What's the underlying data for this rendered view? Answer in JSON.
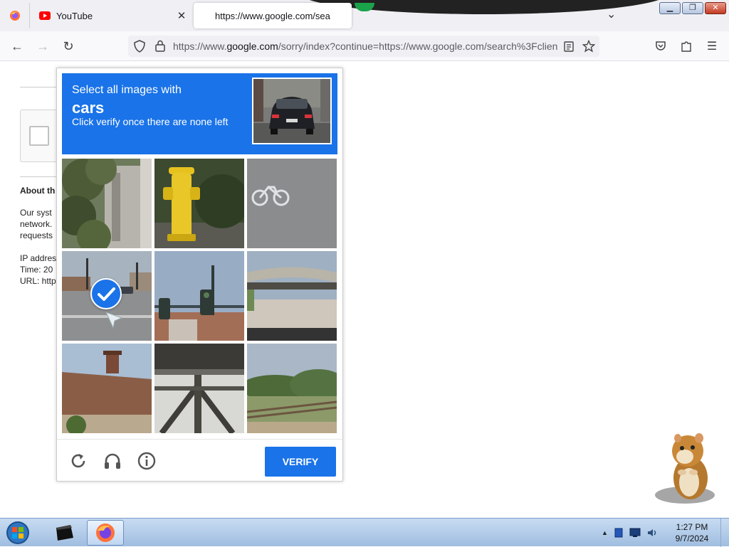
{
  "browser": {
    "tabs": [
      {
        "label": "",
        "icon": "firefox-icon"
      },
      {
        "label": "YouTube",
        "icon": "youtube-icon"
      },
      {
        "label": "https://www.google.com/sea",
        "icon": "",
        "active": true
      }
    ],
    "url_prefix": "https://www.",
    "url_domain": "google.com",
    "url_rest": "/sorry/index?continue=https://www.google.com/search%3Fclient"
  },
  "page": {
    "about_heading": "About th",
    "about_lines": [
      "Our syst",
      "network.",
      "requests"
    ],
    "ip_line": "IP addres",
    "time_line": "Time: 20",
    "url_line": "URL: http"
  },
  "captcha": {
    "instruction": "Select all images with",
    "target": "cars",
    "subtext": "Click verify once there are none left",
    "tiles": [
      {
        "subject": "ivy-covered stone building",
        "selected": false
      },
      {
        "subject": "yellow fire hydrant",
        "selected": false
      },
      {
        "subject": "bike lane marking",
        "selected": false
      },
      {
        "subject": "street intersection with car",
        "selected": true
      },
      {
        "subject": "traffic lights",
        "selected": false
      },
      {
        "subject": "overpass bridge",
        "selected": false
      },
      {
        "subject": "house roof with chimney",
        "selected": false
      },
      {
        "subject": "steel bridge underside",
        "selected": false
      },
      {
        "subject": "trees and fence",
        "selected": false
      }
    ],
    "verify_label": "VERIFY"
  },
  "taskbar": {
    "time": "1:27 PM",
    "date": "9/7/2024"
  },
  "colors": {
    "captcha_blue": "#1a73e8",
    "taskbar": "#b5cde8"
  }
}
